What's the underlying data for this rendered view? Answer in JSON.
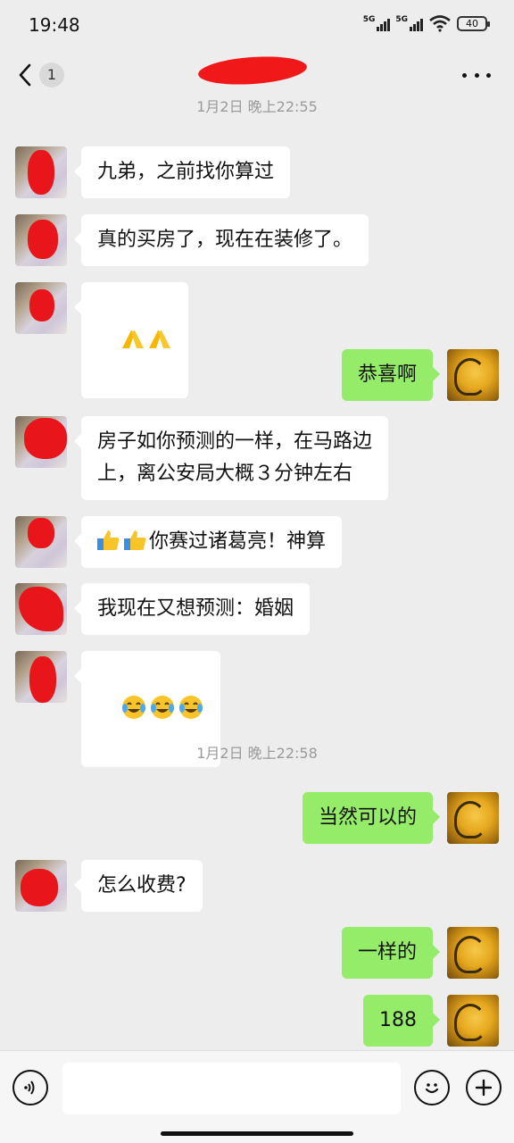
{
  "status_bar": {
    "time": "19:48",
    "sig1_label": "5G",
    "sig2_label": "5G",
    "battery": "40",
    "icons": [
      "signal-icon",
      "signal-icon",
      "wifi-icon",
      "battery-icon"
    ]
  },
  "nav": {
    "unread_count": "1",
    "icons": [
      "back-arrow-icon",
      "more-icon"
    ]
  },
  "chat": {
    "timestamps": [
      "1月2日 晚上22:55",
      "1月2日 晚上22:58"
    ],
    "messages": [
      {
        "from": "peer",
        "text": "九弟，之前找你算过"
      },
      {
        "from": "peer",
        "text": "真的买房了，现在在装修了。"
      },
      {
        "from": "peer",
        "text": "",
        "emoji": [
          "folded-hands-emoji",
          "folded-hands-emoji"
        ]
      },
      {
        "from": "me",
        "text": "恭喜啊"
      },
      {
        "from": "peer",
        "text": "房子如你预测的一样，在马路边\n上，离公安局大概３分钟左右"
      },
      {
        "from": "peer",
        "text": "你赛过诸葛亮！神算",
        "emoji": [
          "thumbs-up-emoji",
          "thumbs-up-emoji"
        ]
      },
      {
        "from": "peer",
        "text": "我现在又想预测：婚姻"
      },
      {
        "from": "peer",
        "text": "",
        "emoji": [
          "crying-laughing-emoji",
          "crying-laughing-emoji",
          "crying-laughing-emoji"
        ]
      },
      {
        "from": "me",
        "text": "当然可以的"
      },
      {
        "from": "peer",
        "text": "怎么收费?"
      },
      {
        "from": "me",
        "text": "一样的"
      },
      {
        "from": "me",
        "text": "188"
      }
    ]
  },
  "input_bar": {
    "message_value": "",
    "icons": [
      "voice-icon",
      "emoji-icon",
      "plus-icon"
    ]
  },
  "colors": {
    "background": "#ededed",
    "incoming_bubble": "#ffffff",
    "outgoing_bubble": "#95ec69",
    "redaction": "#e8161a"
  }
}
